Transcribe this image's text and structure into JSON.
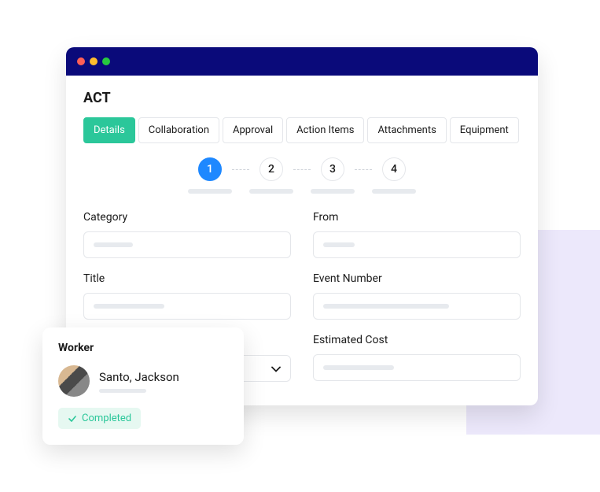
{
  "app": {
    "title": "ACT"
  },
  "tabs": [
    {
      "label": "Details",
      "active": true
    },
    {
      "label": "Collaboration",
      "active": false
    },
    {
      "label": "Approval",
      "active": false
    },
    {
      "label": "Action Items",
      "active": false
    },
    {
      "label": "Attachments",
      "active": false
    },
    {
      "label": "Equipment",
      "active": false
    }
  ],
  "steps": [
    "1",
    "2",
    "3",
    "4"
  ],
  "activeStep": 0,
  "fields": {
    "left": [
      {
        "label": "Category"
      },
      {
        "label": "Title"
      },
      {
        "label": "",
        "dropdown": true
      }
    ],
    "right": [
      {
        "label": "From"
      },
      {
        "label": "Event Number"
      },
      {
        "label": "Estimated Cost"
      }
    ]
  },
  "worker": {
    "title": "Worker",
    "name": "Santo, Jackson",
    "status": "Completed"
  }
}
